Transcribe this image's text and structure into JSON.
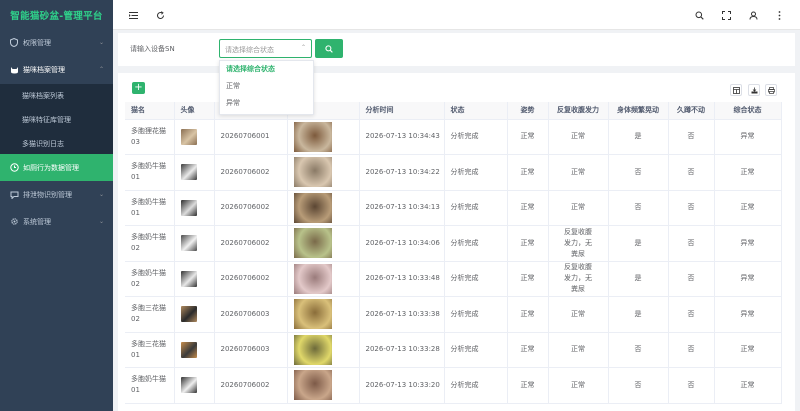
{
  "app": {
    "title": "智能猫砂盆-管理平台"
  },
  "sidebar": {
    "items": [
      {
        "label": "权限管理",
        "icon": "shield-icon"
      },
      {
        "label": "猫咪档案管理",
        "icon": "cat-icon"
      },
      {
        "label": "猫咪档案列表"
      },
      {
        "label": "猫咪特征库管理"
      },
      {
        "label": "多猫识别日志"
      },
      {
        "label": "如厕行为数据管理",
        "icon": "clock-icon"
      },
      {
        "label": "排泄物识别管理",
        "icon": "chat-icon"
      },
      {
        "label": "系统管理",
        "icon": "gear-icon"
      }
    ]
  },
  "search": {
    "sn_label": "请输入设备SN",
    "select_placeholder": "请选择综合状态",
    "options": [
      "请选择综合状态",
      "正常",
      "异常"
    ]
  },
  "table": {
    "columns": [
      "猫名",
      "头像",
      "设备SN",
      "图像",
      "分析时间",
      "状态",
      "姿势",
      "反复收腹发力",
      "身体频繁晃动",
      "久蹲不动",
      "综合状态"
    ],
    "rows": [
      {
        "name": "多胞狸花猫03",
        "sn": "20260706001",
        "time": "2026-07-13 10:34:43",
        "status": "分析完成",
        "posture": "正常",
        "strain": "正常",
        "shake": "是",
        "squat": "否",
        "overall": "异常"
      },
      {
        "name": "多胞奶牛猫01",
        "sn": "20260706002",
        "time": "2026-07-13 10:34:22",
        "status": "分析完成",
        "posture": "正常",
        "strain": "正常",
        "shake": "否",
        "squat": "否",
        "overall": "正常"
      },
      {
        "name": "多胞奶牛猫01",
        "sn": "20260706002",
        "time": "2026-07-13 10:34:13",
        "status": "分析完成",
        "posture": "正常",
        "strain": "正常",
        "shake": "否",
        "squat": "否",
        "overall": "正常"
      },
      {
        "name": "多胞奶牛猫02",
        "sn": "20260706002",
        "time": "2026-07-13 10:34:06",
        "status": "分析完成",
        "posture": "正常",
        "strain": "反复收腹发力，无粪尿",
        "shake": "是",
        "squat": "否",
        "overall": "异常"
      },
      {
        "name": "多胞奶牛猫02",
        "sn": "20260706002",
        "time": "2026-07-13 10:33:48",
        "status": "分析完成",
        "posture": "正常",
        "strain": "反复收腹发力，无粪尿",
        "shake": "是",
        "squat": "否",
        "overall": "异常"
      },
      {
        "name": "多胞三花猫02",
        "sn": "20260706003",
        "time": "2026-07-13 10:33:38",
        "status": "分析完成",
        "posture": "正常",
        "strain": "正常",
        "shake": "是",
        "squat": "否",
        "overall": "异常"
      },
      {
        "name": "多胞三花猫01",
        "sn": "20260706003",
        "time": "2026-07-13 10:33:28",
        "status": "分析完成",
        "posture": "正常",
        "strain": "正常",
        "shake": "否",
        "squat": "否",
        "overall": "正常"
      },
      {
        "name": "多胞奶牛猫01",
        "sn": "20260706002",
        "time": "2026-07-13 10:33:20",
        "status": "分析完成",
        "posture": "正常",
        "strain": "正常",
        "shake": "否",
        "squat": "否",
        "overall": "正常"
      }
    ]
  },
  "colors": {
    "accent": "#2fb36e",
    "sidebar": "#304156",
    "logo": "#2fd18a"
  }
}
